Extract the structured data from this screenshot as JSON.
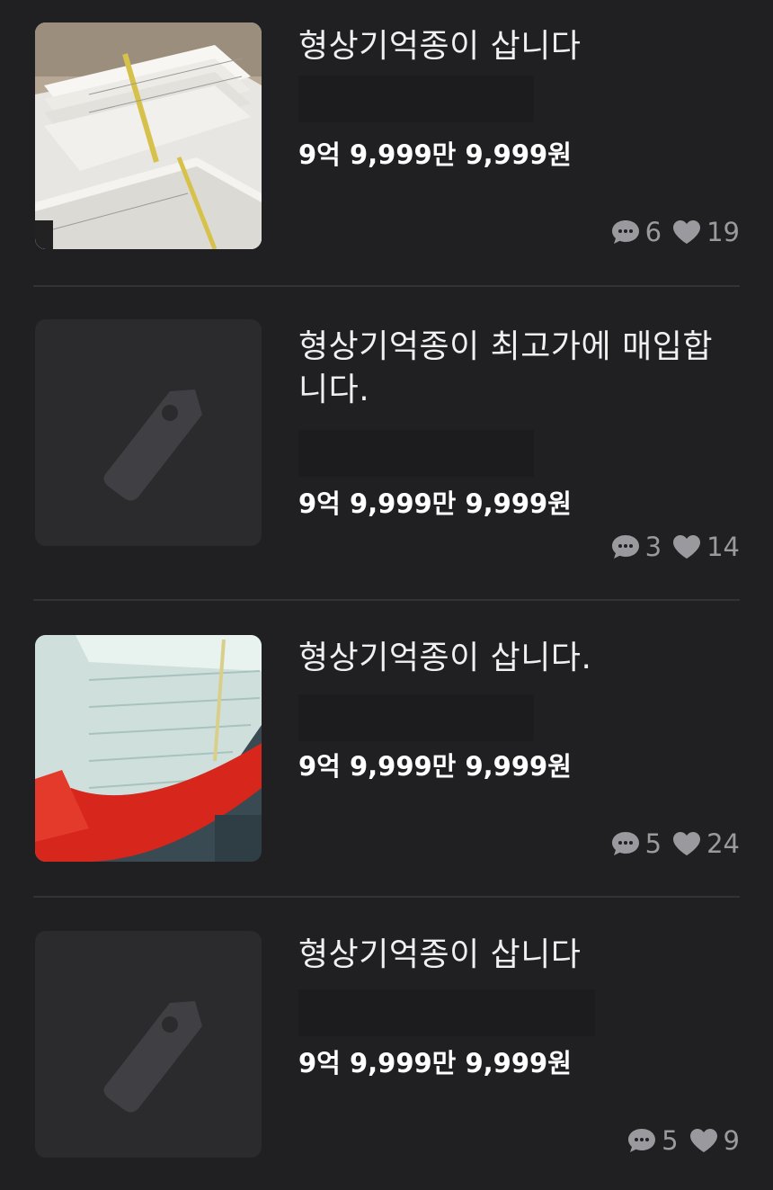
{
  "listings": [
    {
      "title": "형상기억종이 삽니다",
      "price": "9억 9,999만 9,999원",
      "comments": "6",
      "likes": "19",
      "thumbnail": "photo-paper-stack-box"
    },
    {
      "title_line1": "형상기억종이 최고가에 매입합",
      "title_line2": "니다.",
      "price": "9억 9,999만 9,999원",
      "comments": "3",
      "likes": "14",
      "thumbnail": "tag-icon"
    },
    {
      "title": "형상기억종이 삽니다.",
      "price": "9억 9,999만 9,999원",
      "comments": "5",
      "likes": "24",
      "thumbnail": "photo-paper-stack-basket"
    },
    {
      "title": "형상기억종이 삽니다",
      "price": "9억 9,999만 9,999원",
      "comments": "5",
      "likes": "9",
      "thumbnail": "tag-icon"
    }
  ],
  "colors": {
    "background": "#202022",
    "placeholder": "#2b2b2e",
    "tag": "#404044",
    "stat": "#9a9a9e"
  }
}
